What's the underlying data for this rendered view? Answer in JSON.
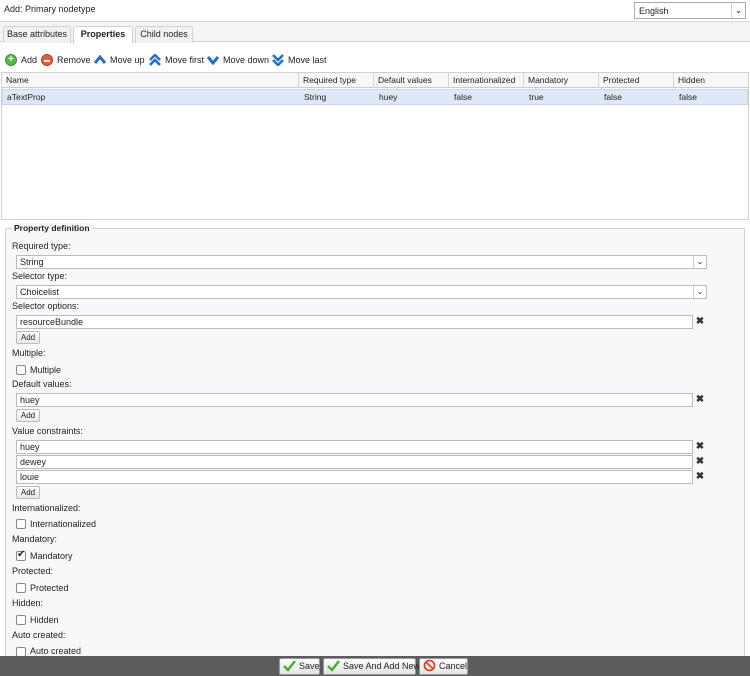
{
  "window": {
    "title": "Add: Primary nodetype"
  },
  "language": {
    "selected": "English"
  },
  "tabs": [
    {
      "label": "Base attributes"
    },
    {
      "label": "Properties"
    },
    {
      "label": "Child nodes"
    }
  ],
  "toolbar": {
    "add": "Add",
    "remove": "Remove",
    "move_up": "Move up",
    "move_first": "Move first",
    "move_down": "Move down",
    "move_last": "Move last"
  },
  "grid": {
    "columns": [
      "Name",
      "Required type",
      "Default values",
      "Internationalized",
      "Mandatory",
      "Protected",
      "Hidden"
    ],
    "rows": [
      [
        "aTextProp",
        "String",
        "huey",
        "false",
        "true",
        "false",
        "false"
      ]
    ]
  },
  "form": {
    "legend": "Property definition",
    "required_type_label": "Required type:",
    "required_type_value": "String",
    "selector_type_label": "Selector type:",
    "selector_type_value": "Choicelist",
    "selector_options_label": "Selector options:",
    "selector_options": [
      "resourceBundle"
    ],
    "add_label": "Add",
    "multiple_label": "Multiple:",
    "multiple_cb": "Multiple",
    "default_values_label": "Default values:",
    "default_values": [
      "huey"
    ],
    "value_constraints_label": "Value constraints:",
    "value_constraints": [
      "huey",
      "dewey",
      "louie"
    ],
    "internationalized_label": "Internationalized:",
    "internationalized_cb": "Internationalized",
    "mandatory_label": "Mandatory:",
    "mandatory_cb": "Mandatory",
    "mandatory_checked": true,
    "protected_label": "Protected:",
    "protected_cb": "Protected",
    "hidden_label": "Hidden:",
    "hidden_cb": "Hidden",
    "auto_created_label": "Auto created:",
    "auto_created_cb": "Auto created"
  },
  "footer": {
    "save": "Save",
    "save_and_add_new": "Save And Add New",
    "cancel": "Cancel"
  }
}
